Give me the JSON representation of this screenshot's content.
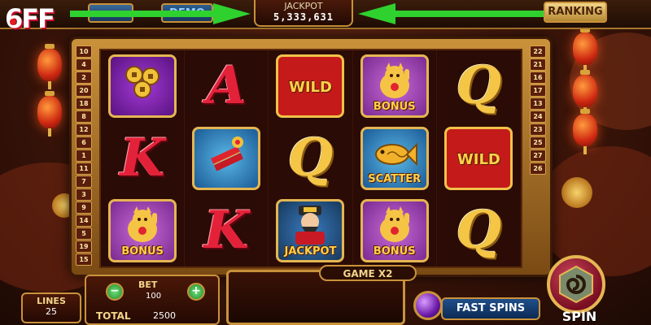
{
  "app": {
    "logo": "6FF"
  },
  "header": {
    "left_button": "",
    "demo_button": "DEMO",
    "jackpot_label": "JACKPOT",
    "jackpot_value": "5,333,631",
    "ranking_button": "RANKING"
  },
  "paylines": {
    "left": [
      "10",
      "4",
      "2",
      "20",
      "18",
      "8",
      "12",
      "6",
      "1",
      "11",
      "7",
      "3",
      "9",
      "14",
      "5",
      "19",
      "15"
    ],
    "right": [
      "22",
      "21",
      "16",
      "17",
      "13",
      "24",
      "23",
      "25",
      "27",
      "26"
    ]
  },
  "reels": [
    [
      {
        "symbol": "coins",
        "label": ""
      },
      {
        "symbol": "K",
        "label": ""
      },
      {
        "symbol": "lucky-cat",
        "label": "BONUS"
      }
    ],
    [
      {
        "symbol": "A",
        "label": ""
      },
      {
        "symbol": "firecracker",
        "label": ""
      },
      {
        "symbol": "K",
        "label": ""
      }
    ],
    [
      {
        "symbol": "wild",
        "label": "WILD"
      },
      {
        "symbol": "Q",
        "label": ""
      },
      {
        "symbol": "god-of-wealth",
        "label": "JACKPOT"
      }
    ],
    [
      {
        "symbol": "lucky-cat",
        "label": "BONUS"
      },
      {
        "symbol": "koi-fish",
        "label": "SCATTER"
      },
      {
        "symbol": "lucky-cat",
        "label": "BONUS"
      }
    ],
    [
      {
        "symbol": "Q",
        "label": ""
      },
      {
        "symbol": "wild",
        "label": "WILD"
      },
      {
        "symbol": "Q",
        "label": ""
      }
    ]
  ],
  "controls": {
    "lines_label": "LINES",
    "lines_value": "25",
    "bet_label": "BET",
    "bet_value": "100",
    "bet_minus": "−",
    "bet_plus": "+",
    "total_label": "TOTAL",
    "total_value": "2500",
    "game_badge": "GAME X2",
    "fast_spins": "FAST SPINS",
    "spin": "SPIN"
  },
  "colors": {
    "arrow": "#2fd12f",
    "gold": "#c9923a"
  }
}
